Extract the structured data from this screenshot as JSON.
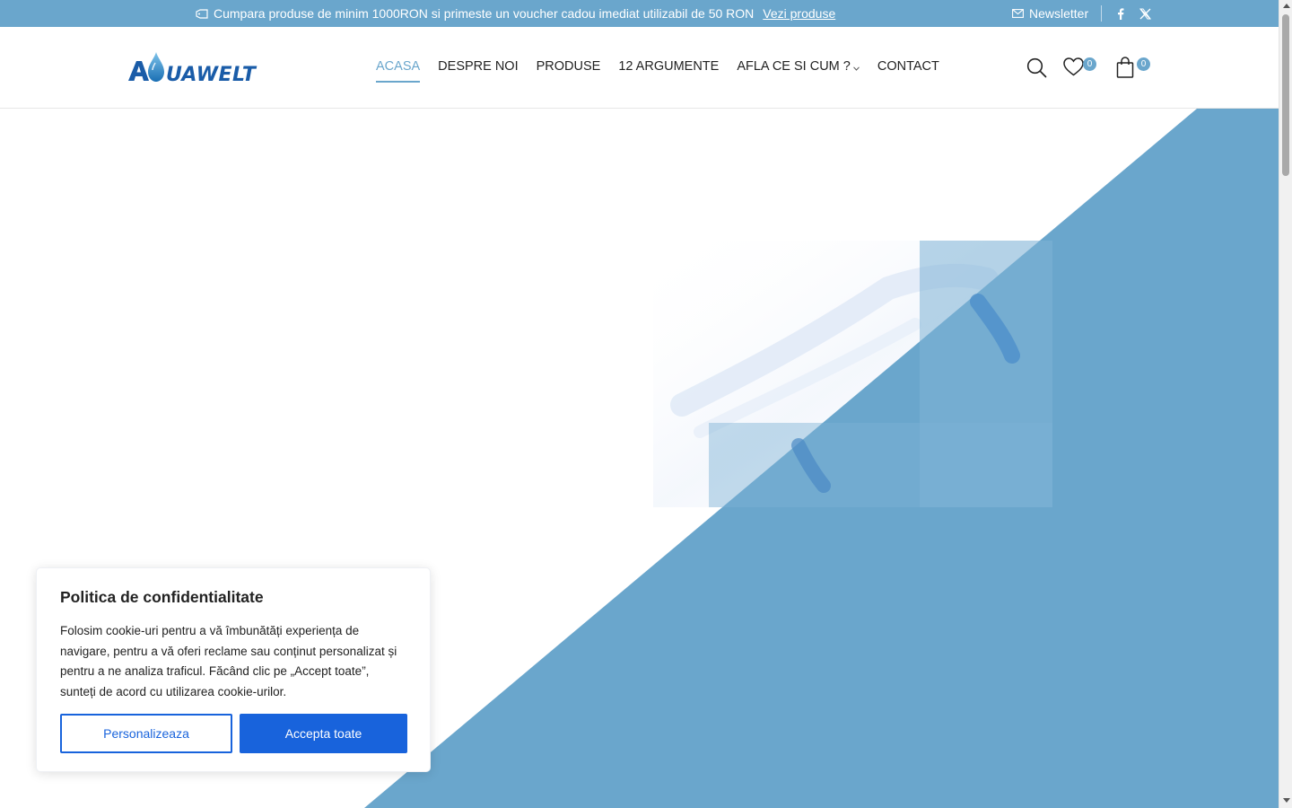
{
  "topbar": {
    "promo_text": "Cumpara produse de minim 1000RON si primeste un voucher cadou imediat utilizabil de 50 RON",
    "promo_link": "Vezi produse",
    "newsletter": "Newsletter",
    "socials": [
      "facebook-icon",
      "x-twitter-icon"
    ],
    "bg_color": "#6aa6cc"
  },
  "header": {
    "logo_text": "AQUAWELT",
    "nav": [
      {
        "label": "ACASA",
        "active": true
      },
      {
        "label": "DESPRE NOI"
      },
      {
        "label": "PRODUSE"
      },
      {
        "label": "12 ARGUMENTE"
      },
      {
        "label": "AFLA CE SI CUM ?",
        "dropdown": true
      },
      {
        "label": "CONTACT"
      }
    ],
    "wishlist_count": "0",
    "cart_count": "0",
    "accent_color": "#6aa6cc"
  },
  "cookie": {
    "title": "Politica de confidentialitate",
    "text": "Folosim cookie-uri pentru a vă îmbunătăți experiența de navigare, pentru a vă oferi reclame sau conținut personalizat și pentru a ne analiza traficul. Făcând clic pe „Accept toate”, sunteți de acord cu utilizarea cookie-urilor.",
    "customize_label": "Personalizeaza",
    "accept_label": "Accepta toate",
    "button_color": "#1863dc"
  }
}
